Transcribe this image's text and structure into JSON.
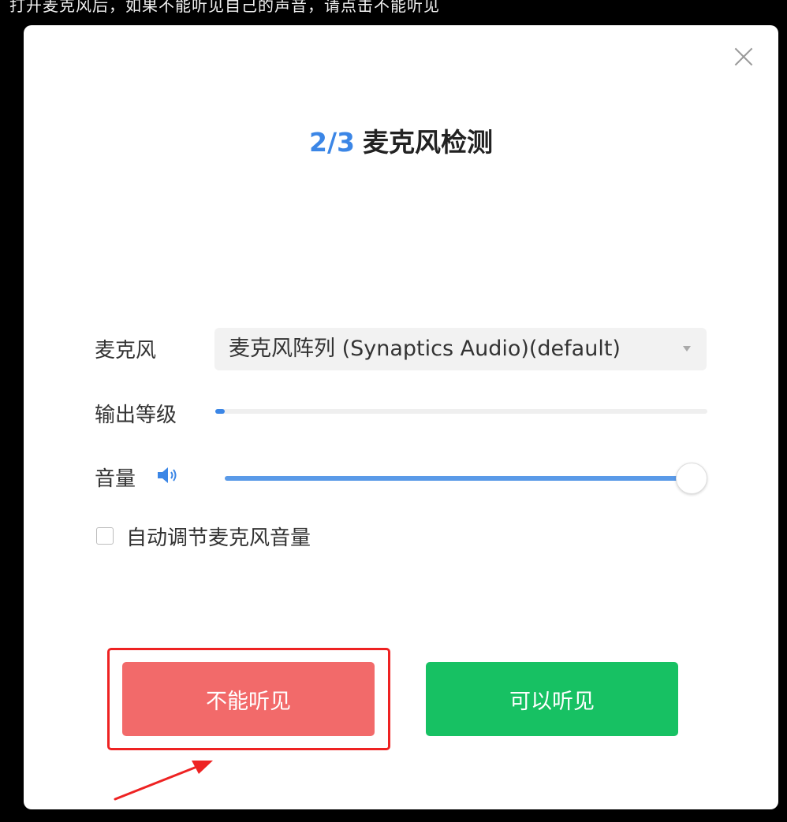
{
  "caption": {
    "text": "打开麦克风后，如果不能听见自己的声音，请点击不能听见"
  },
  "dialog": {
    "step": "2/3",
    "title": "麦克风检测",
    "close_icon": "close-icon"
  },
  "microphone": {
    "label": "麦克风",
    "selected": "麦克风阵列 (Synaptics Audio)(default)"
  },
  "output_level": {
    "label": "输出等级",
    "level": 0.02
  },
  "volume": {
    "label": "音量",
    "icon": "speaker-icon",
    "value": 1.0
  },
  "auto_adjust": {
    "label": "自动调节麦克风音量",
    "checked": false
  },
  "buttons": {
    "cant_hear": "不能听见",
    "can_hear": "可以听见"
  },
  "colors": {
    "accent": "#3b86e6",
    "cant_hear": "#f26a6a",
    "can_hear": "#17c163",
    "annotation": "#ee2222"
  }
}
